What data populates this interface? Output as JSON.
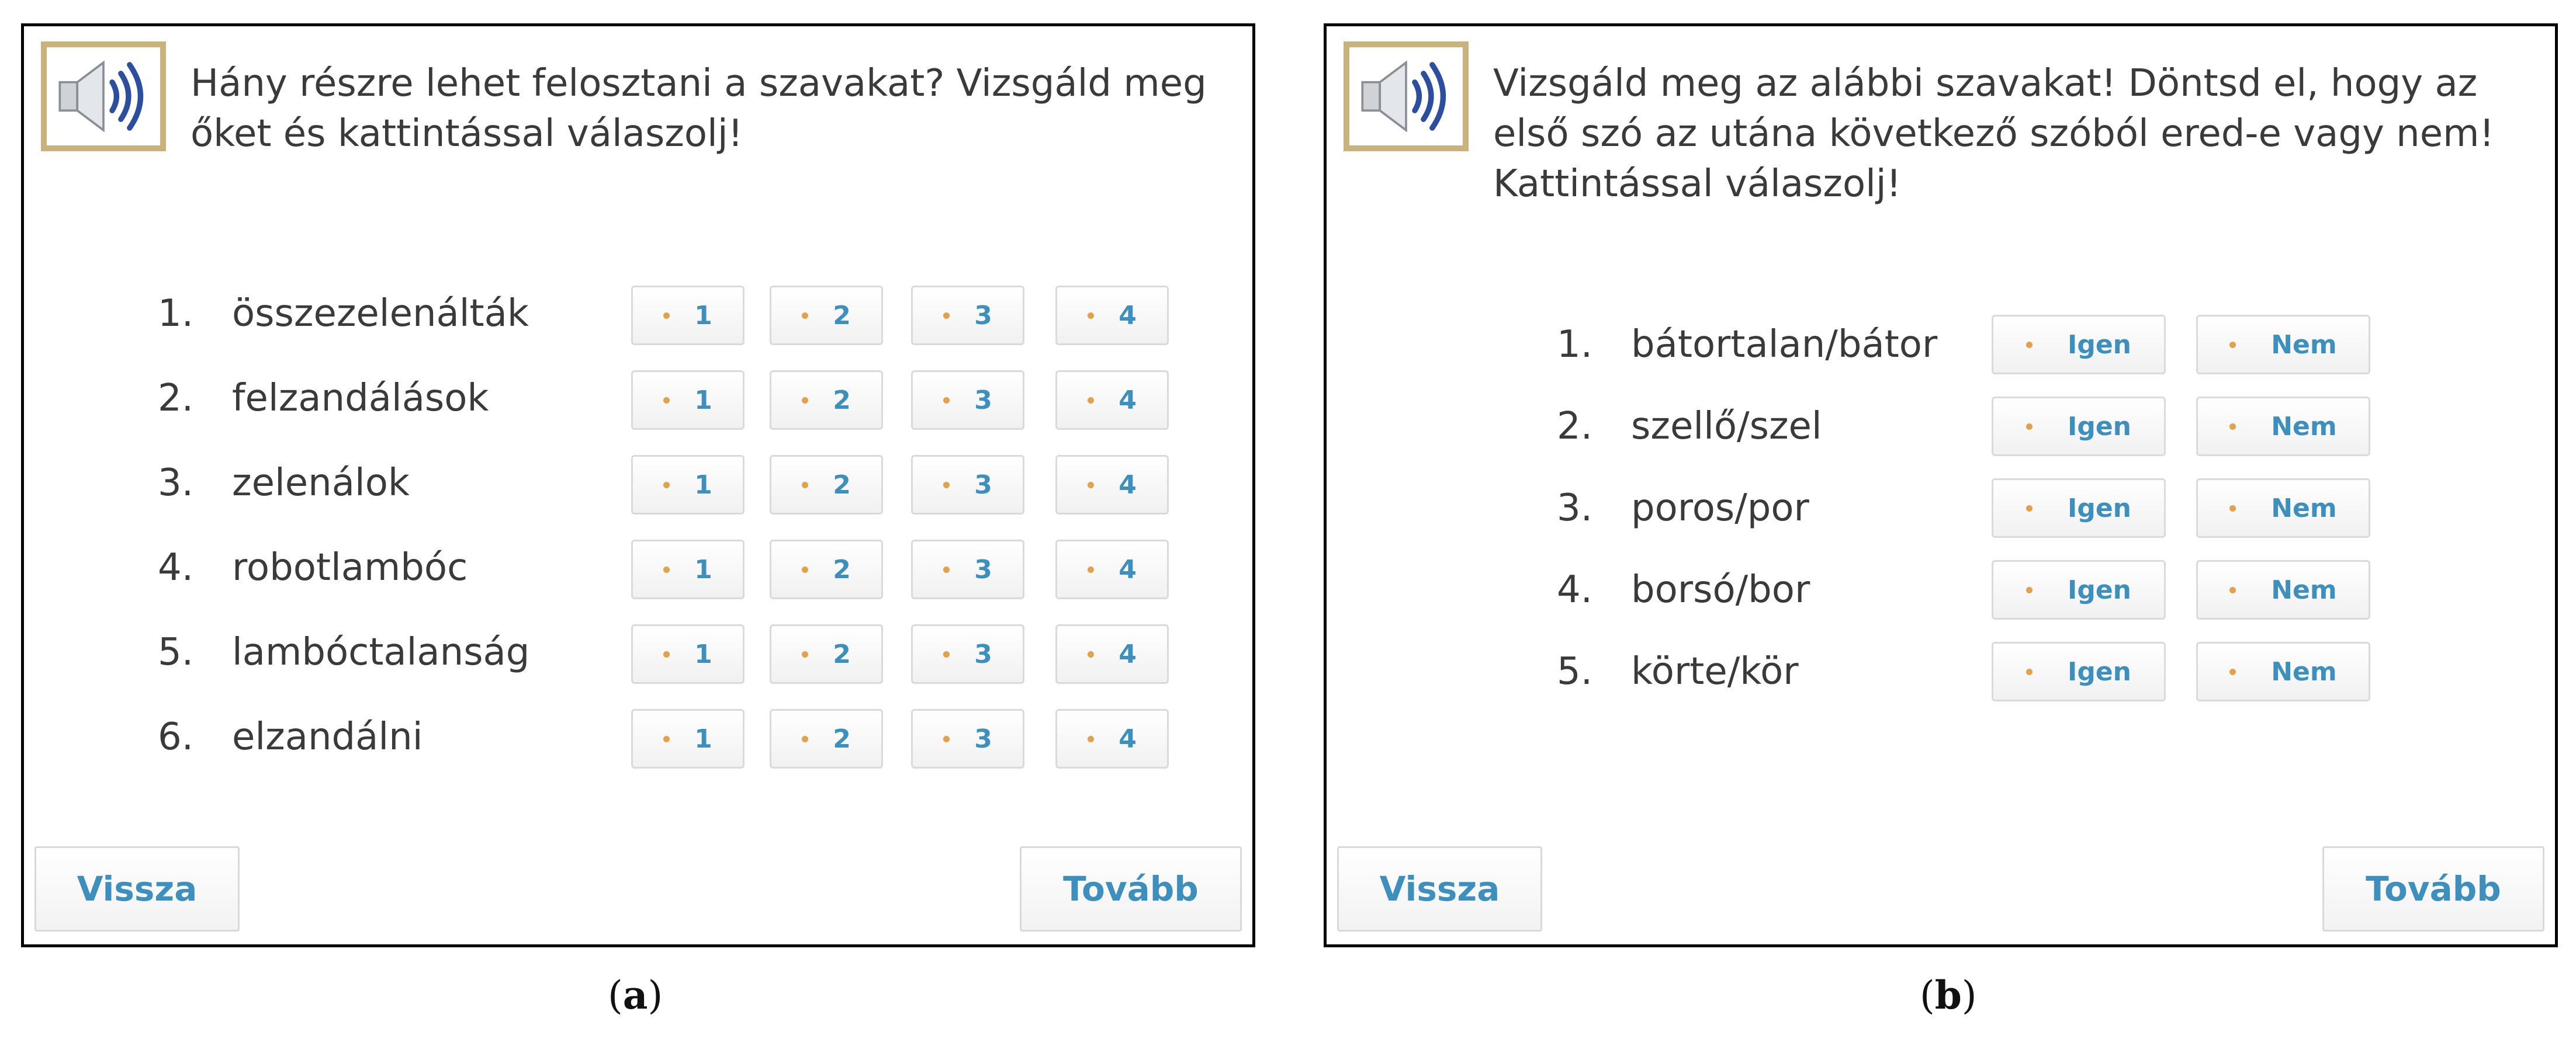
{
  "panel_a": {
    "instruction": "Hány részre lehet felosztani a szavakat? Vizsgáld meg őket és kattintással válaszolj!",
    "speaker_icon": "speaker-icon",
    "rows": [
      {
        "num": "1.",
        "word": "összezelenálták"
      },
      {
        "num": "2.",
        "word": "felzandálások"
      },
      {
        "num": "3.",
        "word": "zelenálok"
      },
      {
        "num": "4.",
        "word": "robotlambóc"
      },
      {
        "num": "5.",
        "word": "lambóctalanság"
      },
      {
        "num": "6.",
        "word": "elzandálni"
      }
    ],
    "options": [
      "1",
      "2",
      "3",
      "4"
    ],
    "back_label": "Vissza",
    "next_label": "Tovább",
    "caption_letter": "a"
  },
  "panel_b": {
    "instruction": "Vizsgáld meg az alábbi szavakat! Döntsd el, hogy az első szó az utána következő szóból ered-e vagy nem! Kattintással válaszolj!",
    "speaker_icon": "speaker-icon",
    "rows": [
      {
        "num": "1.",
        "word": "bátortalan/bátor"
      },
      {
        "num": "2.",
        "word": "szellő/szel"
      },
      {
        "num": "3.",
        "word": "poros/por"
      },
      {
        "num": "4.",
        "word": "borsó/bor"
      },
      {
        "num": "5.",
        "word": "körte/kör"
      }
    ],
    "options": [
      "Igen",
      "Nem"
    ],
    "back_label": "Vissza",
    "next_label": "Tovább",
    "caption_letter": "b"
  },
  "colors": {
    "accent": "#3d8fbd",
    "dot": "#e4a04a",
    "speaker_frame": "#c9b27c",
    "text": "#3a3a3a"
  }
}
